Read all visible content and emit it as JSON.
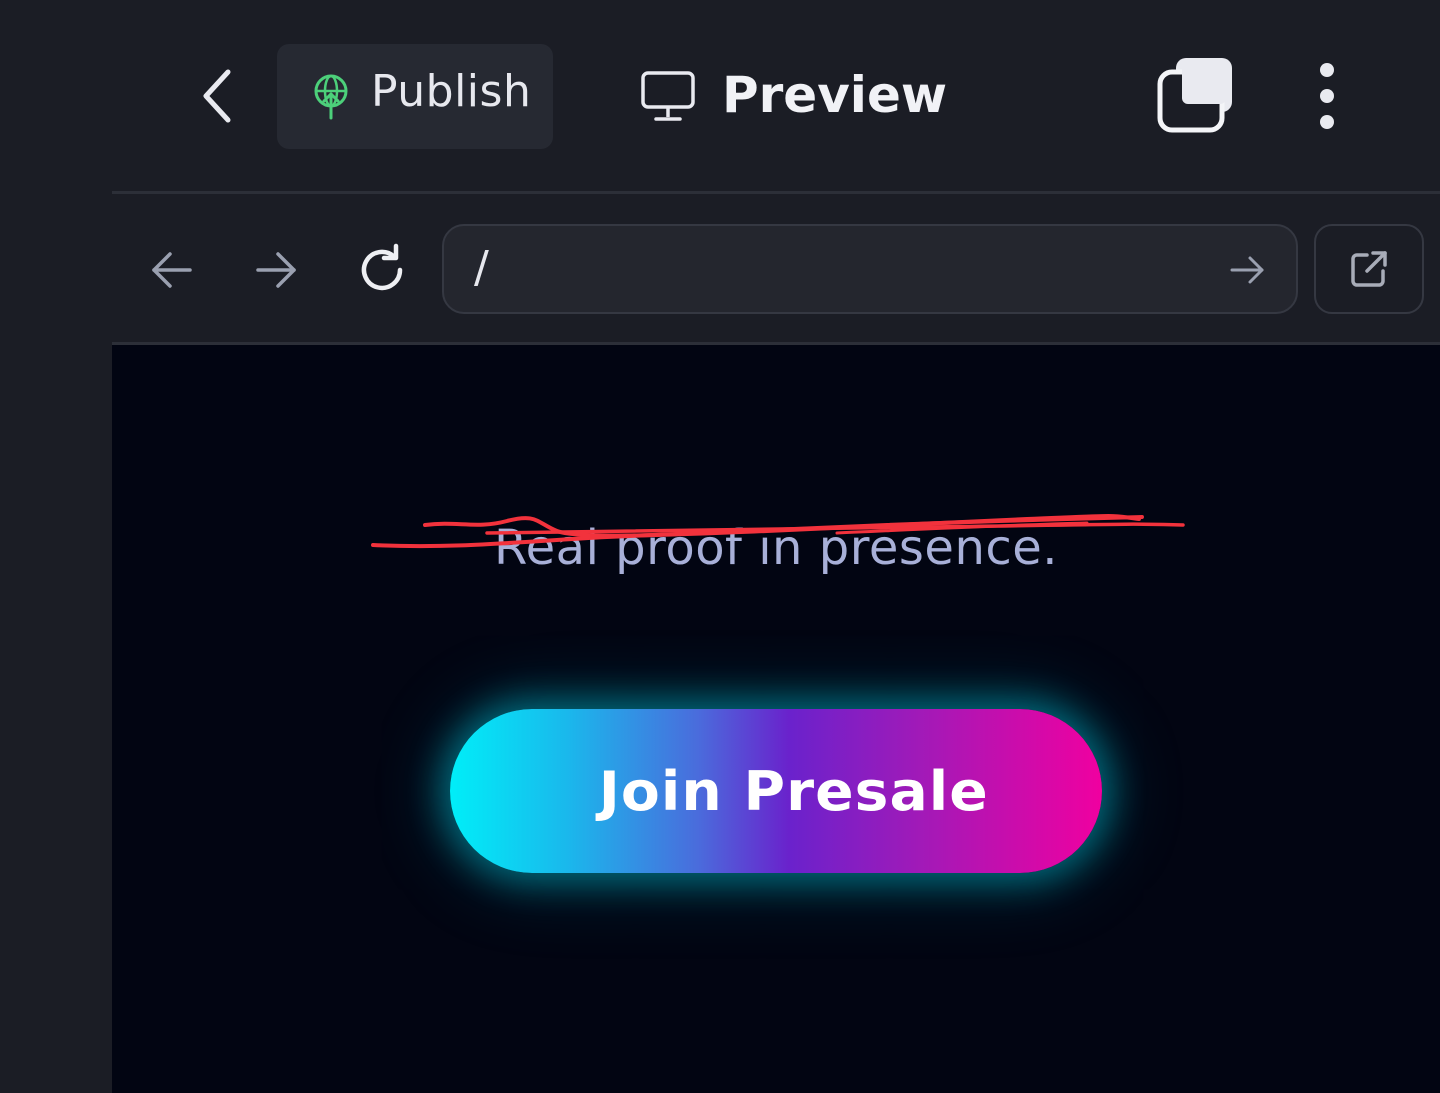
{
  "header": {
    "publish_label": "Publish",
    "preview_label": "Preview",
    "icons": {
      "back": "chevron-left-icon",
      "publish": "globe-upload-icon",
      "preview": "monitor-icon",
      "windows": "stacked-windows-icon",
      "menu": "more-vertical-icon"
    }
  },
  "browser": {
    "url": "/",
    "icons": {
      "nav_back": "arrow-left-icon",
      "nav_forward": "arrow-right-icon",
      "reload": "reload-icon",
      "go": "arrow-right-icon",
      "open_external": "external-link-icon"
    }
  },
  "page": {
    "tagline": "Real proof in presence.",
    "cta_label": "Join Presale"
  },
  "colors": {
    "app_background": "#1b1d25",
    "viewport_background": "#020512",
    "publish_icon": "#4cd07a",
    "tagline": "#a8b0d8",
    "scribble": "#f2323c",
    "cta_gradient_start": "#00eef8",
    "cta_gradient_mid": "#6a22cc",
    "cta_gradient_end": "#f000a0"
  }
}
